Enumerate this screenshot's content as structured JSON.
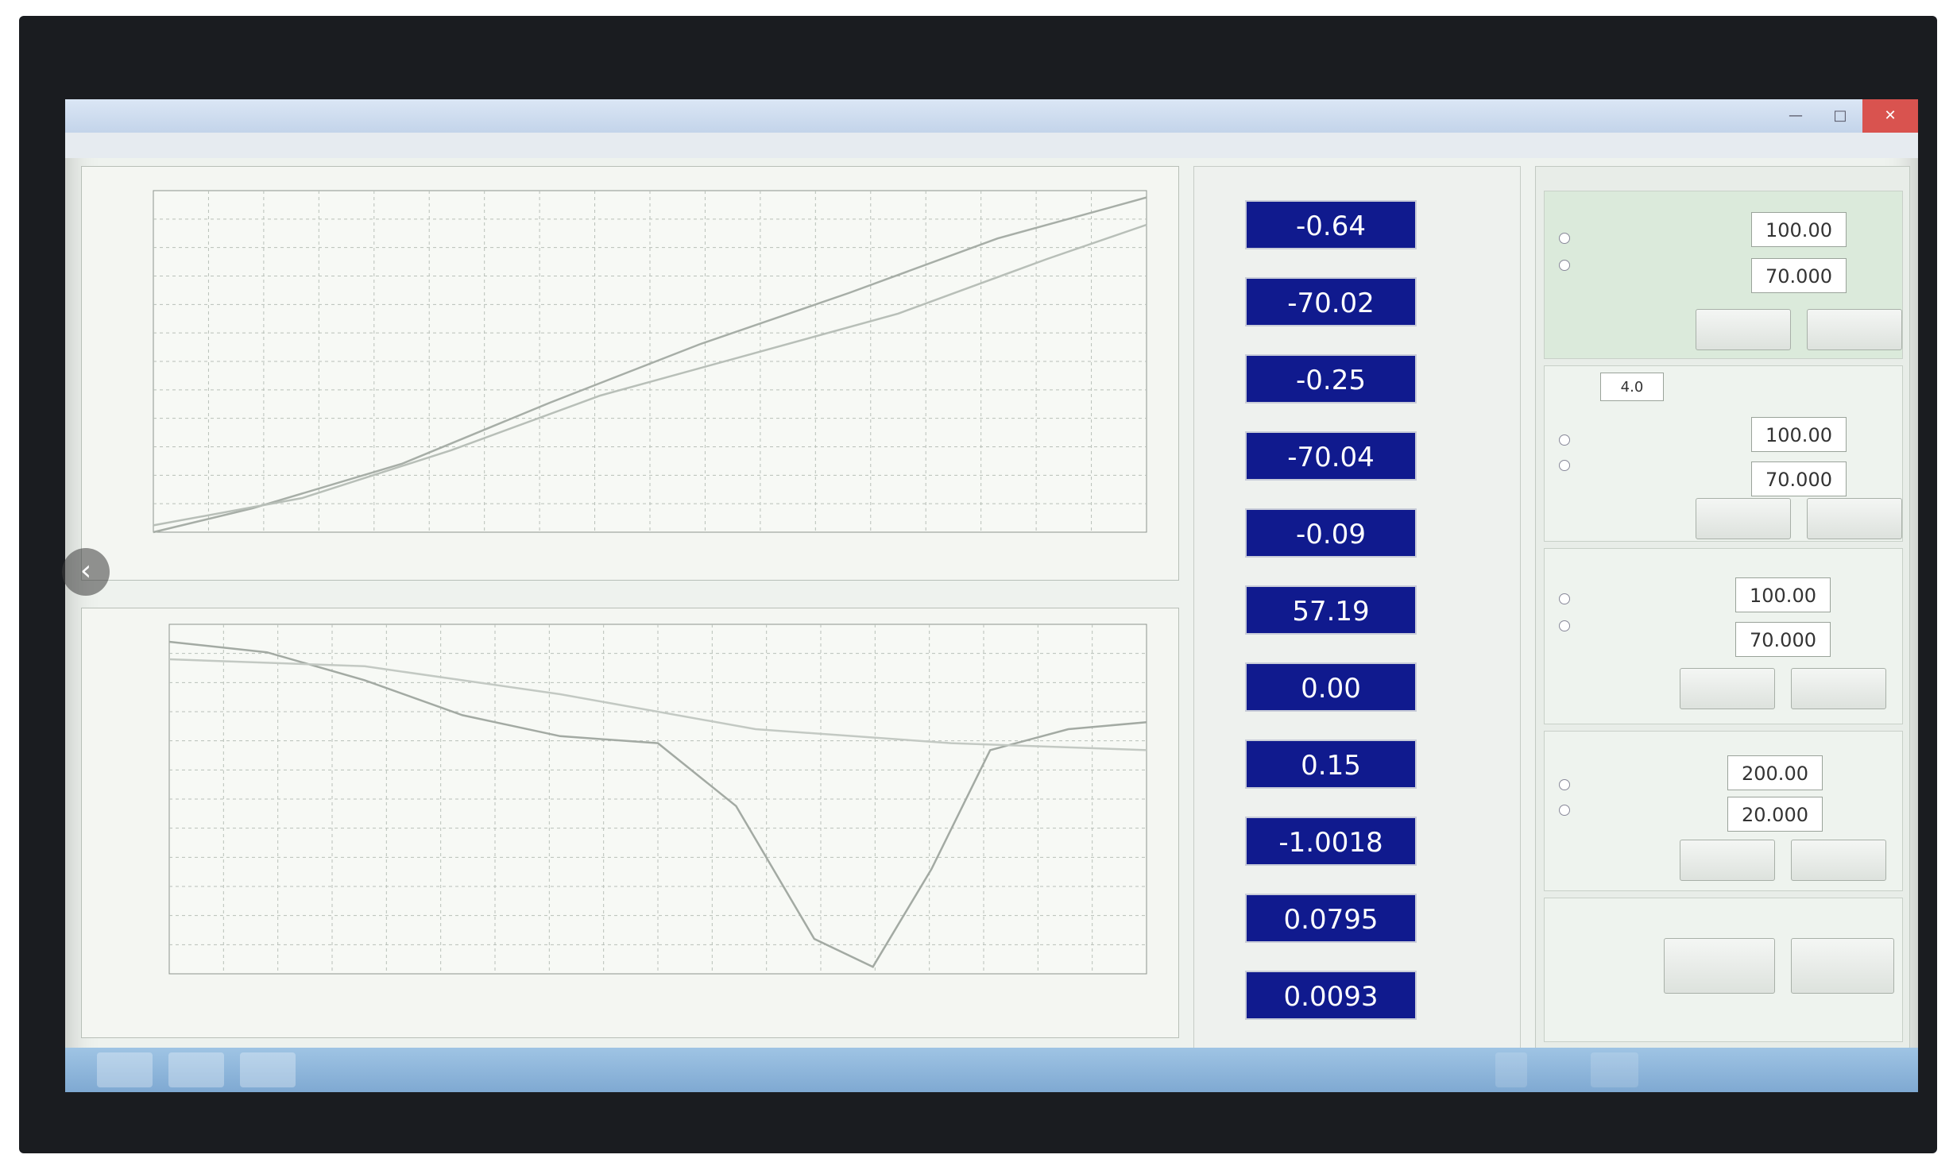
{
  "app": {
    "title": "",
    "menu": [
      "",
      ""
    ]
  },
  "readouts": [
    {
      "value": "-0.64"
    },
    {
      "value": "-70.02"
    },
    {
      "value": "-0.25"
    },
    {
      "value": "-70.04"
    },
    {
      "value": "-0.09"
    },
    {
      "value": "57.19"
    },
    {
      "value": "0.00"
    },
    {
      "value": "0.15"
    },
    {
      "value": "-1.0018"
    },
    {
      "value": "0.0795"
    },
    {
      "value": "0.0093"
    }
  ],
  "controls": {
    "groups": [
      {
        "field1": "100.00",
        "field2": "70.000"
      },
      {
        "field1": "100.00",
        "field2": "70.000",
        "select": "4.0"
      },
      {
        "field1": "100.00",
        "field2": "70.000"
      },
      {
        "field1": "200.00",
        "field2": "20.000"
      }
    ]
  },
  "colors": {
    "readout_bg": "#101a8e",
    "readout_text": "#ffffff",
    "taskbar": "#8fb6dc"
  }
}
